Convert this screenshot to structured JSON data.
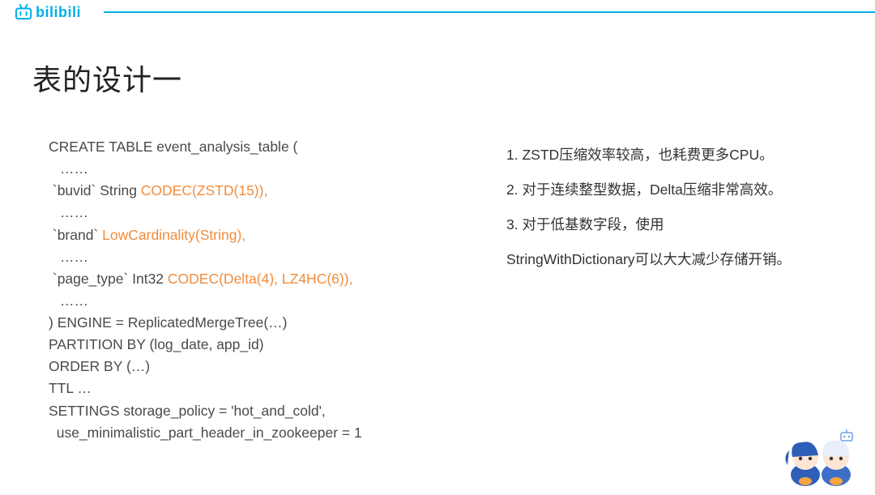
{
  "header": {
    "logo_text": "bilibili"
  },
  "title": "表的设计一",
  "code": {
    "l1": "CREATE TABLE event_analysis_table (",
    "ellipsis": "……",
    "l3a": " `buvid` String ",
    "l3b": "CODEC(ZSTD(15)),",
    "l5a": " `brand` ",
    "l5b": "LowCardinality(String),",
    "l7a": " `page_type` Int32 ",
    "l7b": "CODEC(Delta(4), LZ4HC(6)),",
    "l9": ") ENGINE = ReplicatedMergeTree(…)",
    "l10": "PARTITION BY (log_date, app_id)",
    "l11": "ORDER BY (…)",
    "l12": "TTL …",
    "l13": "SETTINGS storage_policy = 'hot_and_cold',",
    "l14": "  use_minimalistic_part_header_in_zookeeper = 1"
  },
  "notes": {
    "n1": "1. ZSTD压缩效率较高，也耗费更多CPU。",
    "n2": "2. 对于连续整型数据，Delta压缩非常高效。",
    "n3": "3. 对于低基数字段，使用",
    "n4": "StringWithDictionary可以大大减少存储开销。"
  }
}
